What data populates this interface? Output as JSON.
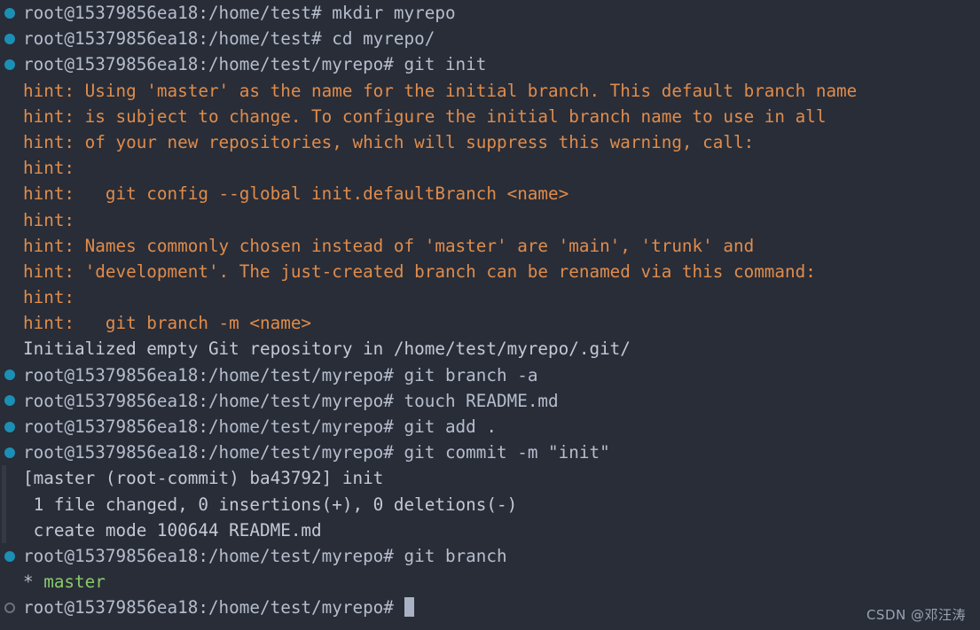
{
  "terminal": {
    "colors": {
      "background": "#282d38",
      "prompt_text": "#b6bdcc",
      "hint_text": "#e08c4b",
      "output_text": "#c3c9d6",
      "branch_green": "#8bc96a",
      "marker_filled": "#1c8fb5",
      "marker_hollow": "#6b7280",
      "gutter": "#343944",
      "cursor": "#a9b2c3"
    },
    "prompt_short": "root@15379856ea18:/home/test# ",
    "prompt_repo": "root@15379856ea18:/home/test/myrepo# ",
    "cursor_glyph": "block-cursor",
    "lines": [
      {
        "marker": "filled",
        "kind": "prompt",
        "prompt": "root@15379856ea18:/home/test# ",
        "command": "mkdir myrepo"
      },
      {
        "marker": "filled",
        "kind": "prompt",
        "prompt": "root@15379856ea18:/home/test# ",
        "command": "cd myrepo/"
      },
      {
        "marker": "filled",
        "kind": "prompt",
        "prompt": "root@15379856ea18:/home/test/myrepo# ",
        "command": "git init"
      },
      {
        "marker": "none",
        "kind": "hint",
        "text": "hint: Using 'master' as the name for the initial branch. This default branch name"
      },
      {
        "marker": "none",
        "kind": "hint",
        "text": "hint: is subject to change. To configure the initial branch name to use in all"
      },
      {
        "marker": "none",
        "kind": "hint",
        "text": "hint: of your new repositories, which will suppress this warning, call:"
      },
      {
        "marker": "none",
        "kind": "hint",
        "text": "hint:"
      },
      {
        "marker": "none",
        "kind": "hint",
        "text": "hint:   git config --global init.defaultBranch <name>"
      },
      {
        "marker": "none",
        "kind": "hint",
        "text": "hint:"
      },
      {
        "marker": "none",
        "kind": "hint",
        "text": "hint: Names commonly chosen instead of 'master' are 'main', 'trunk' and"
      },
      {
        "marker": "none",
        "kind": "hint",
        "text": "hint: 'development'. The just-created branch can be renamed via this command:"
      },
      {
        "marker": "none",
        "kind": "hint",
        "text": "hint:"
      },
      {
        "marker": "none",
        "kind": "hint",
        "text": "hint:   git branch -m <name>"
      },
      {
        "marker": "none",
        "kind": "output",
        "text": "Initialized empty Git repository in /home/test/myrepo/.git/"
      },
      {
        "marker": "filled",
        "kind": "prompt",
        "prompt": "root@15379856ea18:/home/test/myrepo# ",
        "command": "git branch -a"
      },
      {
        "marker": "filled",
        "kind": "prompt",
        "prompt": "root@15379856ea18:/home/test/myrepo# ",
        "command": "touch README.md"
      },
      {
        "marker": "filled",
        "kind": "prompt",
        "prompt": "root@15379856ea18:/home/test/myrepo# ",
        "command": "git add ."
      },
      {
        "marker": "filled",
        "kind": "prompt",
        "prompt": "root@15379856ea18:/home/test/myrepo# ",
        "command": "git commit -m \"init\""
      },
      {
        "marker": "none",
        "kind": "output",
        "gutter": true,
        "text": "[master (root-commit) ba43792] init"
      },
      {
        "marker": "none",
        "kind": "output",
        "gutter": true,
        "text": " 1 file changed, 0 insertions(+), 0 deletions(-)"
      },
      {
        "marker": "none",
        "kind": "output",
        "gutter": true,
        "text": " create mode 100644 README.md"
      },
      {
        "marker": "filled",
        "kind": "prompt",
        "prompt": "root@15379856ea18:/home/test/myrepo# ",
        "command": "git branch"
      },
      {
        "marker": "none",
        "kind": "branch",
        "star": "* ",
        "branch_name": "master"
      },
      {
        "marker": "hollow",
        "kind": "prompt_cursor",
        "prompt": "root@15379856ea18:/home/test/myrepo# ",
        "command": ""
      }
    ]
  },
  "watermark": {
    "text": "CSDN @邓汪涛"
  }
}
